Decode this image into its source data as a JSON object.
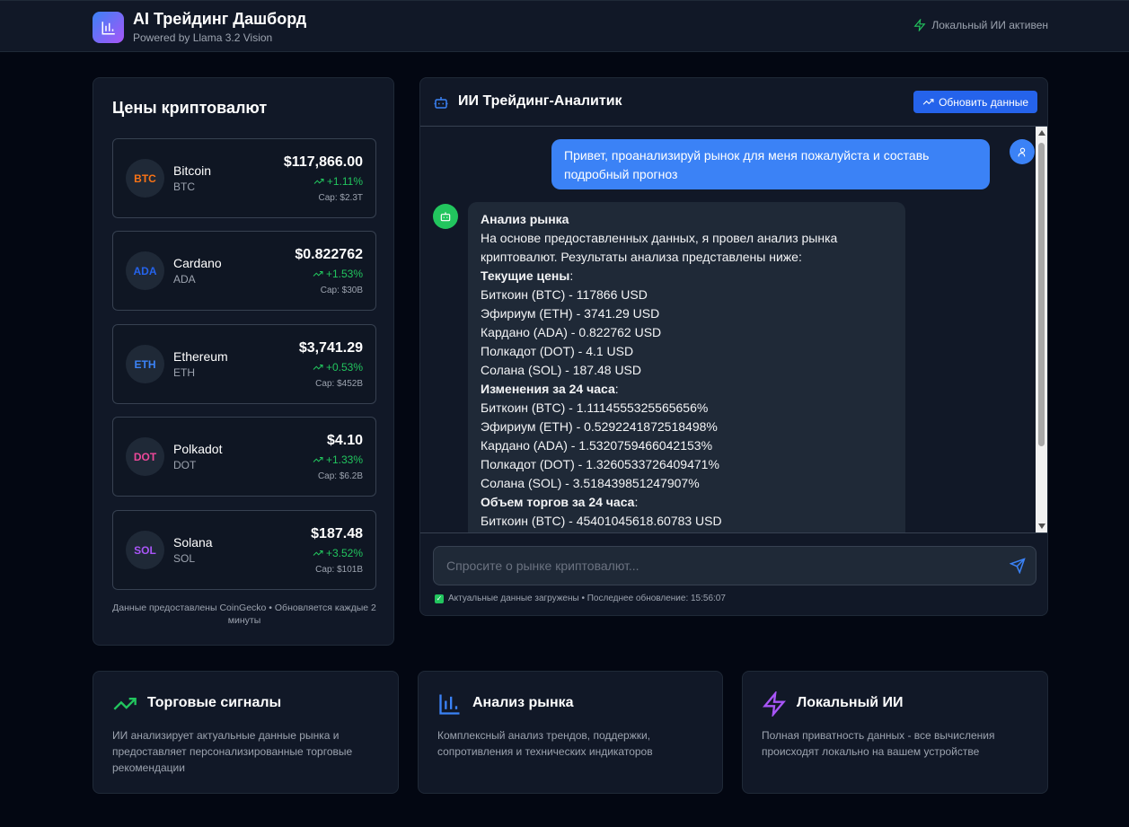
{
  "header": {
    "title": "AI Трейдинг Дашборд",
    "subtitle": "Powered by Llama 3.2 Vision",
    "ai_status": "Локальный ИИ активен"
  },
  "prices": {
    "title": "Цены криптовалют",
    "coins": [
      {
        "badge": "BTC",
        "name": "Bitcoin",
        "symbol": "BTC",
        "price": "$117,866.00",
        "change": "+1.11%",
        "cap": "Cap: $2.3T",
        "color": "#f97316"
      },
      {
        "badge": "ADA",
        "name": "Cardano",
        "symbol": "ADA",
        "price": "$0.822762",
        "change": "+1.53%",
        "cap": "Cap: $30B",
        "color": "#2563eb"
      },
      {
        "badge": "ETH",
        "name": "Ethereum",
        "symbol": "ETH",
        "price": "$3,741.29",
        "change": "+0.53%",
        "cap": "Cap: $452B",
        "color": "#3b82f6"
      },
      {
        "badge": "DOT",
        "name": "Polkadot",
        "symbol": "DOT",
        "price": "$4.10",
        "change": "+1.33%",
        "cap": "Cap: $6.2B",
        "color": "#ec4899"
      },
      {
        "badge": "SOL",
        "name": "Solana",
        "symbol": "SOL",
        "price": "$187.48",
        "change": "+3.52%",
        "cap": "Cap: $101B",
        "color": "#a855f7"
      }
    ],
    "footer": "Данные предоставлены CoinGecko • Обновляется каждые 2 минуты"
  },
  "chat": {
    "title": "ИИ Трейдинг-Аналитик",
    "refresh_label": "Обновить данные",
    "user_message": "Привет, проанализируй рынок для меня пожалуйста и составь подробный прогноз",
    "bot_lines": [
      {
        "text": "Анализ рынка",
        "bold": true
      },
      {
        "text": "На основе предоставленных данных, я провел анализ рынка криптовалют. Результаты анализа представлены ниже:",
        "bold": false
      },
      {
        "text": "Текущие цены",
        "bold": true,
        "suffix": ":"
      },
      {
        "text": "Биткоин (BTC) - 117866 USD",
        "bold": false
      },
      {
        "text": "Эфириум (ETH) - 3741.29 USD",
        "bold": false
      },
      {
        "text": "Кардано (ADA) - 0.822762 USD",
        "bold": false
      },
      {
        "text": "Полкадот (DOT) - 4.1 USD",
        "bold": false
      },
      {
        "text": "Солана (SOL) - 187.48 USD",
        "bold": false
      },
      {
        "text": "Изменения за 24 часа",
        "bold": true,
        "suffix": ":"
      },
      {
        "text": "Биткоин (BTC) - 1.1114555325565656%",
        "bold": false
      },
      {
        "text": "Эфириум (ETH) - 0.5292241872518498%",
        "bold": false
      },
      {
        "text": "Кардано (ADA) - 1.5320759466042153%",
        "bold": false
      },
      {
        "text": "Полкадот (DOT) - 1.3260533726409471%",
        "bold": false
      },
      {
        "text": "Солана (SOL) - 3.518439851247907%",
        "bold": false
      },
      {
        "text": "Объем торгов за 24 часа",
        "bold": true,
        "suffix": ":"
      },
      {
        "text": "Биткоин (BTC) - 45401045618.60783 USD",
        "bold": false
      }
    ],
    "input_placeholder": "Спросите о рынке криптовалют...",
    "status": "Актуальные данные загружены • Последнее обновление: 15:56:07"
  },
  "features": [
    {
      "title": "Торговые сигналы",
      "desc": "ИИ анализирует актуальные данные рынка и предоставляет персонализированные торговые рекомендации",
      "icon": "trending-up-icon",
      "color": "#22c55e"
    },
    {
      "title": "Анализ рынка",
      "desc": "Комплексный анализ трендов, поддержки, сопротивления и технических индикаторов",
      "icon": "bar-chart-icon",
      "color": "#3b82f6"
    },
    {
      "title": "Локальный ИИ",
      "desc": "Полная приватность данных - все вычисления происходят локально на вашем устройстве",
      "icon": "zap-icon",
      "color": "#a855f7"
    }
  ]
}
